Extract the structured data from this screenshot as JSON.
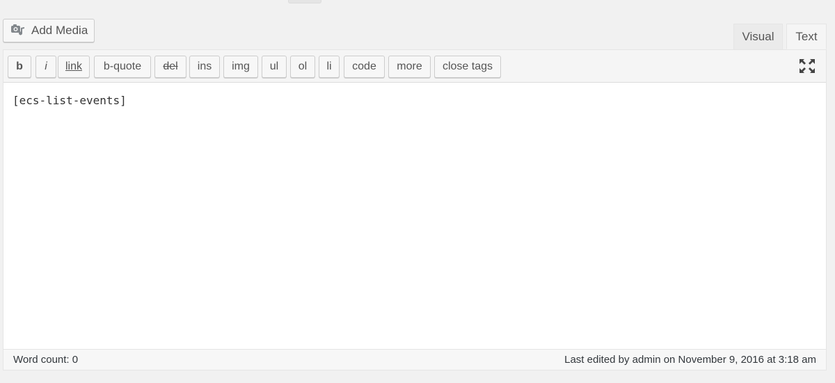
{
  "media": {
    "add_media_label": "Add Media"
  },
  "mode_tabs": {
    "visual": "Visual",
    "text": "Text"
  },
  "toolbar": {
    "buttons": [
      {
        "label": "b"
      },
      {
        "label": "i"
      },
      {
        "label": "link"
      },
      {
        "label": "b-quote"
      },
      {
        "label": "del"
      },
      {
        "label": "ins"
      },
      {
        "label": "img"
      },
      {
        "label": "ul"
      },
      {
        "label": "ol"
      },
      {
        "label": "li"
      },
      {
        "label": "code"
      },
      {
        "label": "more"
      },
      {
        "label": "close tags"
      }
    ],
    "fullscreen_icon": "fullscreen-icon"
  },
  "editor": {
    "content": "[ecs-list-events]"
  },
  "status": {
    "word_count": "Word count: 0",
    "last_edited": "Last edited by admin on November 9, 2016 at 3:18 am"
  },
  "colors": {
    "background": "#f1f1f1",
    "toolbar": "#f5f5f5",
    "button": "#f7f7f7",
    "border": "#cccccc",
    "text": "#555555"
  }
}
